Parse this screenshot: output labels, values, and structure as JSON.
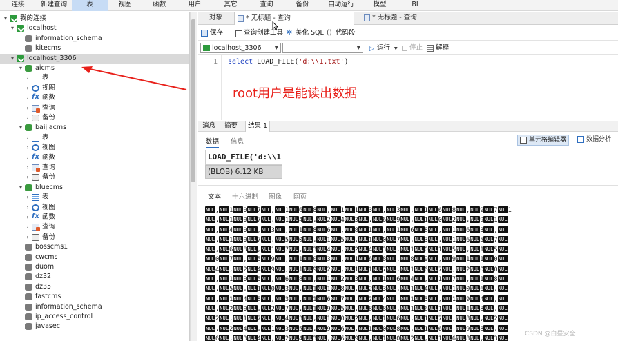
{
  "menu": {
    "items": [
      "连接",
      "新建查询",
      "表",
      "视图",
      "函数",
      "用户",
      "其它",
      "查询",
      "备份",
      "自动运行",
      "模型",
      "BI"
    ],
    "active_index": 2
  },
  "tree": {
    "root_label": "我的连接",
    "rows": [
      {
        "label": "我的连接",
        "icon": "connections-group-icon",
        "level": 0,
        "arrow": "▾"
      },
      {
        "label": "localhost",
        "icon": "connection-icon",
        "level": 1,
        "arrow": "▾"
      },
      {
        "label": "information_schema",
        "icon": "database-icon",
        "level": 2,
        "arrow": ""
      },
      {
        "label": "kitecms",
        "icon": "database-icon",
        "level": 2,
        "arrow": ""
      },
      {
        "label": "localhost_3306",
        "icon": "connection-icon",
        "level": 1,
        "arrow": "▾",
        "selected": true
      },
      {
        "label": "aicms",
        "icon": "database-open-icon",
        "level": 2,
        "arrow": "▾"
      },
      {
        "label": "表",
        "icon": "table-icon",
        "level": 3,
        "arrow": "›"
      },
      {
        "label": "视图",
        "icon": "view-icon",
        "level": 3,
        "arrow": "›"
      },
      {
        "label": "函数",
        "icon": "function-icon",
        "level": 3,
        "arrow": "›"
      },
      {
        "label": "查询",
        "icon": "query-icon",
        "level": 3,
        "arrow": "›"
      },
      {
        "label": "备份",
        "icon": "backup-icon",
        "level": 3,
        "arrow": "›"
      },
      {
        "label": "baijiacms",
        "icon": "database-open-icon",
        "level": 2,
        "arrow": "▾"
      },
      {
        "label": "表",
        "icon": "table-icon",
        "level": 3,
        "arrow": "›"
      },
      {
        "label": "视图",
        "icon": "view-icon",
        "level": 3,
        "arrow": "›"
      },
      {
        "label": "函数",
        "icon": "function-icon",
        "level": 3,
        "arrow": "›"
      },
      {
        "label": "查询",
        "icon": "query-icon",
        "level": 3,
        "arrow": "›"
      },
      {
        "label": "备份",
        "icon": "backup-icon",
        "level": 3,
        "arrow": "›"
      },
      {
        "label": "bluecms",
        "icon": "database-open-icon",
        "level": 2,
        "arrow": "▾"
      },
      {
        "label": "表",
        "icon": "table-icon",
        "level": 3,
        "arrow": "›"
      },
      {
        "label": "视图",
        "icon": "view-icon",
        "level": 3,
        "arrow": "›"
      },
      {
        "label": "函数",
        "icon": "function-icon",
        "level": 3,
        "arrow": "›"
      },
      {
        "label": "查询",
        "icon": "query-icon",
        "level": 3,
        "arrow": "›"
      },
      {
        "label": "备份",
        "icon": "backup-icon",
        "level": 3,
        "arrow": "›"
      },
      {
        "label": "bosscms1",
        "icon": "database-icon",
        "level": 2,
        "arrow": ""
      },
      {
        "label": "cwcms",
        "icon": "database-icon",
        "level": 2,
        "arrow": ""
      },
      {
        "label": "duomi",
        "icon": "database-icon",
        "level": 2,
        "arrow": ""
      },
      {
        "label": "dz32",
        "icon": "database-icon",
        "level": 2,
        "arrow": ""
      },
      {
        "label": "dz35",
        "icon": "database-icon",
        "level": 2,
        "arrow": ""
      },
      {
        "label": "fastcms",
        "icon": "database-icon",
        "level": 2,
        "arrow": ""
      },
      {
        "label": "information_schema",
        "icon": "database-icon",
        "level": 2,
        "arrow": ""
      },
      {
        "label": "ip_access_control",
        "icon": "database-icon",
        "level": 2,
        "arrow": ""
      },
      {
        "label": "javasec",
        "icon": "database-icon",
        "level": 2,
        "arrow": ""
      }
    ]
  },
  "tabs": {
    "objects_label": "对象",
    "query_tab_1": "* 无标题 - 查询",
    "query_tab_2": "* 无标题 - 查询",
    "close_glyph": "×"
  },
  "toolbar": {
    "save": "保存",
    "query_builder": "查询创建工具",
    "beautify": "美化 SQL",
    "snippet": "代码段"
  },
  "run_bar": {
    "connection": "localhost_3306",
    "database": "",
    "run": "运行",
    "stop": "停止",
    "explain": "解释"
  },
  "editor": {
    "line_number": "1",
    "keyword": "select",
    "function": "LOAD_FILE(",
    "string": "'d:\\\\1.txt'",
    "close": ")",
    "annotation": "root用户是能读出数据",
    "annotation_color": "#e8201a"
  },
  "result_tabs": {
    "messages": "消息",
    "summary": "摘要",
    "result": "结果 1"
  },
  "result_subtabs": {
    "data": "数据",
    "info": "信息",
    "cell_editor": "单元格编辑器",
    "data_analysis": "数据分析"
  },
  "grid": {
    "header": "LOAD_FILE('d:\\\\1",
    "value": "(BLOB) 6.12 KB"
  },
  "viewer_tabs": {
    "text": "文本",
    "hex": "十六进制",
    "image": "图像",
    "web": "网页"
  },
  "blob": {
    "null_token": "NUL",
    "rows": [
      "NUL,NUL1NUL0NUL7NUL,NUL1NUL6NUL8NUL,NUL1NUL1NUL3NUL,NUL3NUL,NUL1NUL6NUL8NUL,NUL9NUL7NUL1",
      "NUL,NUL1NUL0NUL7NUL,NUL1NUL4NUL,NUL2NUL4NUL3NUL,NUL6NUL9NUL,NUL1NUL0NUL2NUL,NUL9NUL1NUL",
      "NUL,NUL4NUL0NUL,NUL3NUL,NUL1NUL8NUL6NUL,NUL8NUL1NUL,NUL1NUL6NUL8NUL,NUL1NUL6NUL3NUL,NUL",
      "NUL,NUL1NUL0NUL7NUL,NUL5NUL0NUL,NUL1NUL5NUL,NUL1NUL0NUL7NUL,NUL3NUL,NUL1NUL6NUL5NUL7NUL",
      "NUL,NUL6NUL8NUL,NUL1NUL7NUL,NUL3NUL4NUL,NUL2NUL4NUL3NUL,NUL1NUL0NUL1NUL5NUL,NUL1NUL5NUL",
      "NUL0NUL7NUL,NUL5NUL9NUL,NUL1NUL0NUL3NUL,NUL1NUL6NUL8NUL,NUL8NUL9NUL,NUL9NUL1NUL1NUL0NUL",
      "NUL4NUL,NUL2NUL4NUL9NUL,NUL1NUL9NUL2NUL,NUL1NUL1NUL7NUL,NUL1NUL6NUL7NUL,NUL2NUL0NUL0NUL",
      "NUL,NUL1NUL0NUL5NUL,NUL6NUL8NUL,NUL1NUL2NUL3NUL,NUL1NUL6NUL4NUL,NUL1NUL7NUL,NUL1NUL8NUL",
      "NUL,NUL5NUL,NUL1NUL0NUL3NUL,NUL1NUL1NUL8NUL,NUL2NUL3NUL,NUL1NUL4NUL,NUL1NUL0NUL6NUL,NUL",
      "NUL,NUL1NUL4NUL8NUL,NUL3NUL,NUL1NUL6NUL7NUL,NUL2NUL4NUL,NUL1NUL3NUL,NUL1NUL9NUL4NUL,NUL",
      "NUL,NUL2NUL0NUL,NUL2NUL7NUL,NUL1NUL9NUL5NUL,NUL8NUL8NUL,NUL1NUL6NUL1NUL,NUL1NUL8NUL,NUL",
      "NUL2NUL,NUL1NUL7NUL,NUL4NUL3NUL,NUL1NUL0NUL2NUL,NUL1NUL6NUL,NUL1NUL7NUL,NUL8NUL,NUL2NUL",
      "NUL,NUL2NUL4NUL,NUL1NUL3NUL5NUL,NUL9NUL6NUL,NUL1NUL0NUL8NUL,NUL1NUL6NUL,NUL9NUL8NUL,NUL",
      "NUL6NUL,NUL3NUL4NUL,NUL2NUL4NUL3NUL,NUL6NUL9NUL,NUL1NUL0NUL2NUL,NUL1NUL6NUL8NUL,NUL3NUL"
    ]
  },
  "watermark": "CSDN @白昼安全"
}
